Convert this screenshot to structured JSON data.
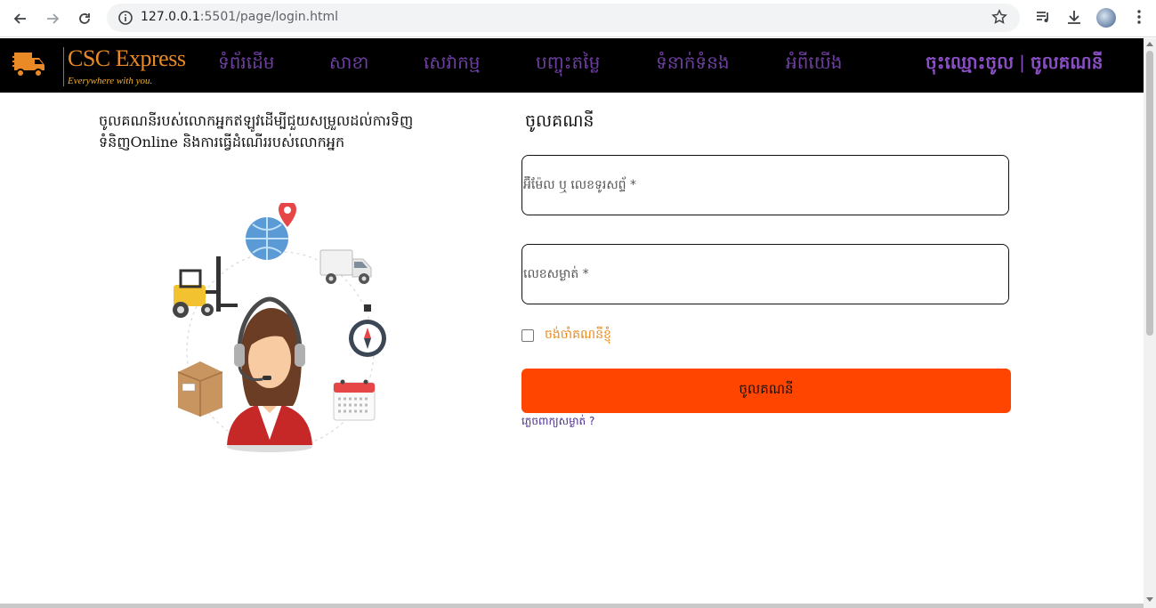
{
  "browser": {
    "url_host": "127.0.0.1",
    "url_rest": ":5501/page/login.html"
  },
  "site": {
    "logo_title": "CSC Express",
    "logo_tagline": "Everywhere with you.",
    "nav": [
      "ទំព័រដើម",
      "សាខា",
      "សេវាកម្ម",
      "បញ្ចុះតម្លៃ",
      "ទំនាក់ទំនង",
      "អំពីយើង"
    ],
    "register_label": "ចុះឈ្មោះចូល",
    "separator": "|",
    "login_label": "ចូលគណនី"
  },
  "intro_text": "ចូលគណនីរបស់លោកអ្នកឥឡូវដើម្បីជួយសម្រួលដល់ការទិញ ទំនិញOnline និងការធ្វើដំណើររបស់លោកអ្នក",
  "form": {
    "title": "ចូលគណនី",
    "email_placeholder": "អ៊ីម៉ែល ឬ លេខទូរសព្ទ័ *",
    "password_placeholder": "លេខសម្ងាត់ *",
    "remember_label": "ចង់ចាំគណនីខ្ញុំ",
    "submit_label": "ចូលគណនី",
    "forgot_label": "ភ្លេចពាក្យសម្ងាត់ ?"
  },
  "colors": {
    "nav_bg": "#000000",
    "nav_link": "#6e3fa0",
    "button": "#ff4500",
    "remember_text": "#e8891c"
  }
}
